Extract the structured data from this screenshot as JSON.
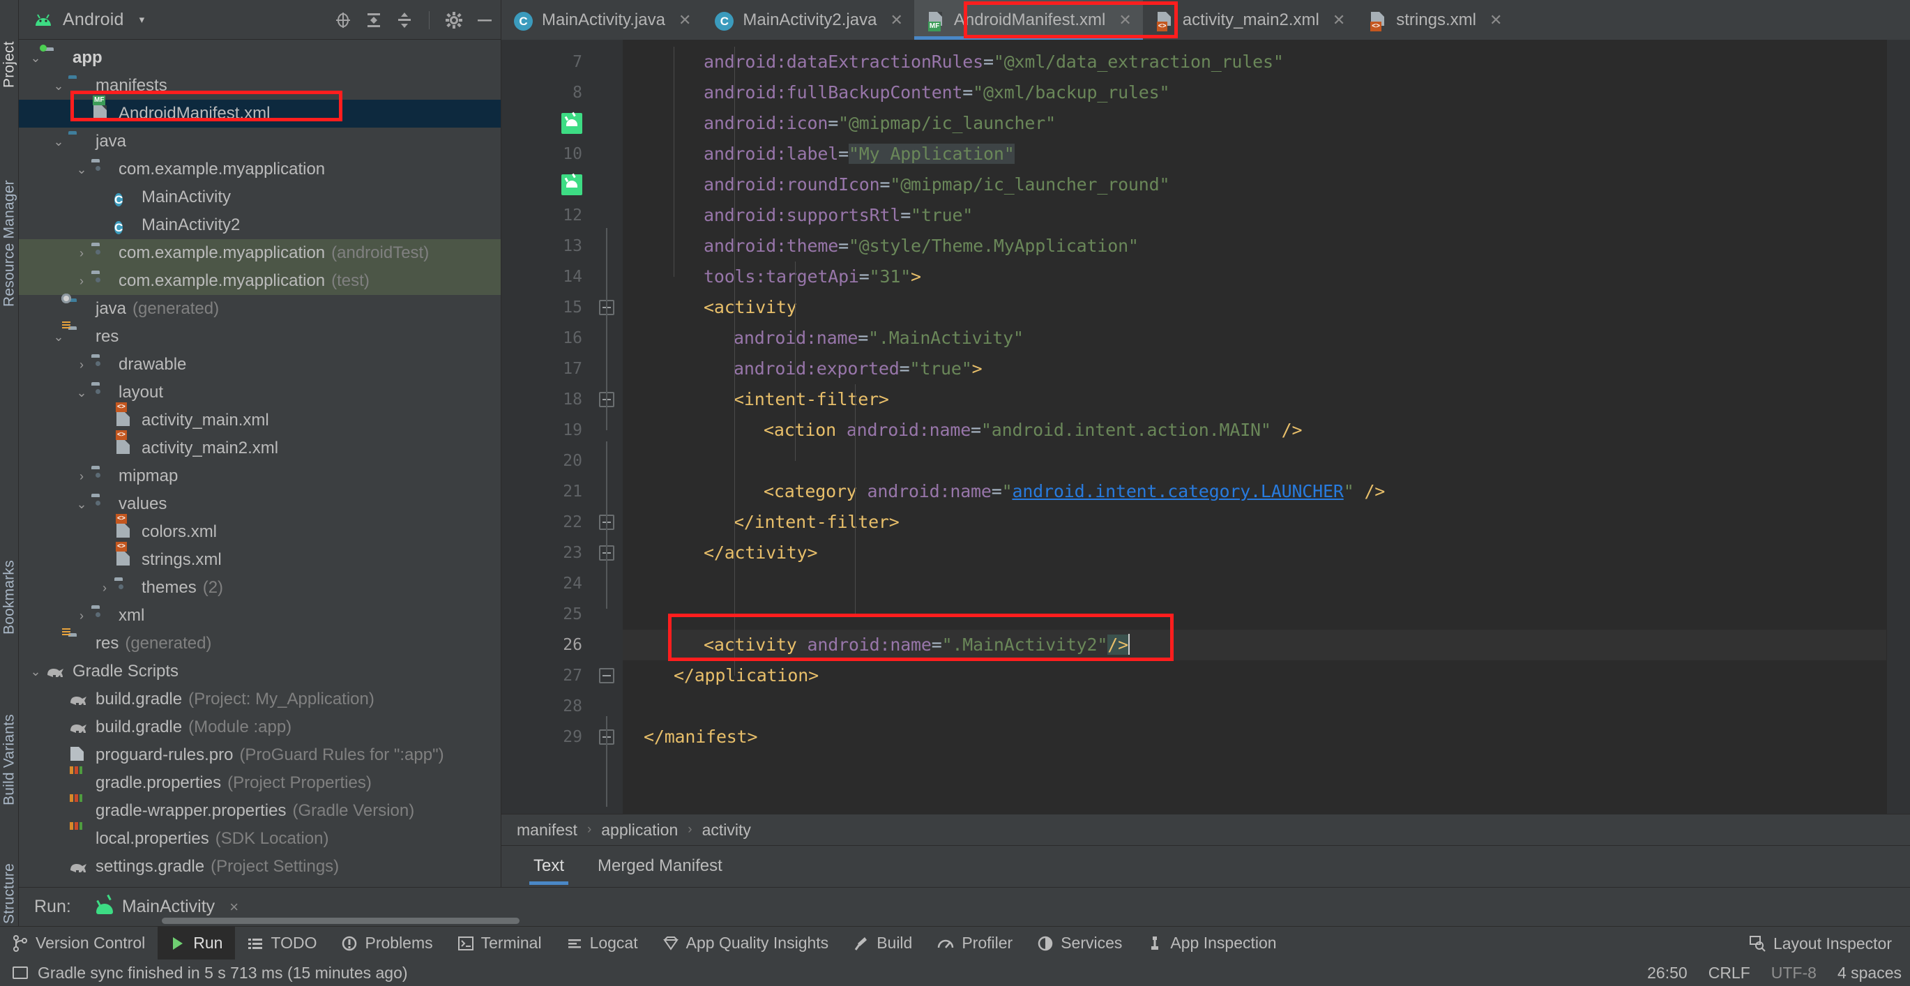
{
  "window": {
    "project_panel_title": "Android",
    "project_vertical_tab": "Project",
    "resource_manager_vertical_tab": "Resource Manager",
    "bookmarks_vertical_tab": "Bookmarks",
    "build_variants_vertical_tab": "Build Variants",
    "structure_vertical_tab": "Structure"
  },
  "project_toolbar": {
    "icons": [
      "locate-icon",
      "expand-all-icon",
      "collapse-all-icon",
      "gear-icon",
      "minimize-icon"
    ]
  },
  "tree": [
    {
      "label": "app",
      "sub": "",
      "depth": 0,
      "arrow": "down",
      "icon": "folder-module",
      "bold": true,
      "state": "normal"
    },
    {
      "label": "manifests",
      "sub": "",
      "depth": 1,
      "arrow": "down",
      "icon": "folder-blue",
      "bold": false,
      "state": "normal"
    },
    {
      "label": "AndroidManifest.xml",
      "sub": "",
      "depth": 2,
      "arrow": "none",
      "icon": "file-manifest",
      "bold": false,
      "state": "selected"
    },
    {
      "label": "java",
      "sub": "",
      "depth": 1,
      "arrow": "down",
      "icon": "folder-blue",
      "bold": false,
      "state": "normal"
    },
    {
      "label": "com.example.myapplication",
      "sub": "",
      "depth": 2,
      "arrow": "down",
      "icon": "folder-package",
      "bold": false,
      "state": "normal"
    },
    {
      "label": "MainActivity",
      "sub": "",
      "depth": 3,
      "arrow": "none",
      "icon": "class",
      "bold": false,
      "state": "normal"
    },
    {
      "label": "MainActivity2",
      "sub": "",
      "depth": 3,
      "arrow": "none",
      "icon": "class",
      "bold": false,
      "state": "normal"
    },
    {
      "label": "com.example.myapplication",
      "sub": "(androidTest)",
      "depth": 2,
      "arrow": "right",
      "icon": "folder-package",
      "bold": false,
      "state": "test"
    },
    {
      "label": "com.example.myapplication",
      "sub": "(test)",
      "depth": 2,
      "arrow": "right",
      "icon": "folder-package",
      "bold": false,
      "state": "test"
    },
    {
      "label": "java",
      "sub": "(generated)",
      "depth": 1,
      "arrow": "none",
      "icon": "folder-generated",
      "bold": false,
      "state": "normal"
    },
    {
      "label": "res",
      "sub": "",
      "depth": 1,
      "arrow": "down",
      "icon": "folder-res",
      "bold": false,
      "state": "normal"
    },
    {
      "label": "drawable",
      "sub": "",
      "depth": 2,
      "arrow": "right",
      "icon": "folder-package",
      "bold": false,
      "state": "normal"
    },
    {
      "label": "layout",
      "sub": "",
      "depth": 2,
      "arrow": "down",
      "icon": "folder-package",
      "bold": false,
      "state": "normal"
    },
    {
      "label": "activity_main.xml",
      "sub": "",
      "depth": 3,
      "arrow": "none",
      "icon": "file-xml",
      "bold": false,
      "state": "normal"
    },
    {
      "label": "activity_main2.xml",
      "sub": "",
      "depth": 3,
      "arrow": "none",
      "icon": "file-xml",
      "bold": false,
      "state": "normal"
    },
    {
      "label": "mipmap",
      "sub": "",
      "depth": 2,
      "arrow": "right",
      "icon": "folder-package",
      "bold": false,
      "state": "normal"
    },
    {
      "label": "values",
      "sub": "",
      "depth": 2,
      "arrow": "down",
      "icon": "folder-package",
      "bold": false,
      "state": "normal"
    },
    {
      "label": "colors.xml",
      "sub": "",
      "depth": 3,
      "arrow": "none",
      "icon": "file-xml",
      "bold": false,
      "state": "normal"
    },
    {
      "label": "strings.xml",
      "sub": "",
      "depth": 3,
      "arrow": "none",
      "icon": "file-xml",
      "bold": false,
      "state": "normal"
    },
    {
      "label": "themes",
      "sub": "(2)",
      "depth": 3,
      "arrow": "right",
      "icon": "folder-package",
      "bold": false,
      "state": "normal"
    },
    {
      "label": "xml",
      "sub": "",
      "depth": 2,
      "arrow": "right",
      "icon": "folder-package",
      "bold": false,
      "state": "normal"
    },
    {
      "label": "res",
      "sub": "(generated)",
      "depth": 1,
      "arrow": "none",
      "icon": "folder-res-generated",
      "bold": false,
      "state": "normal"
    },
    {
      "label": "Gradle Scripts",
      "sub": "",
      "depth": 0,
      "arrow": "down",
      "icon": "gradle",
      "bold": false,
      "state": "normal"
    },
    {
      "label": "build.gradle",
      "sub": "(Project: My_Application)",
      "depth": 1,
      "arrow": "none",
      "icon": "gradle",
      "bold": false,
      "state": "normal"
    },
    {
      "label": "build.gradle",
      "sub": "(Module :app)",
      "depth": 1,
      "arrow": "none",
      "icon": "gradle",
      "bold": false,
      "state": "normal"
    },
    {
      "label": "proguard-rules.pro",
      "sub": "(ProGuard Rules for \":app\")",
      "depth": 1,
      "arrow": "none",
      "icon": "file-text",
      "bold": false,
      "state": "normal"
    },
    {
      "label": "gradle.properties",
      "sub": "(Project Properties)",
      "depth": 1,
      "arrow": "none",
      "icon": "file-properties",
      "bold": false,
      "state": "normal"
    },
    {
      "label": "gradle-wrapper.properties",
      "sub": "(Gradle Version)",
      "depth": 1,
      "arrow": "none",
      "icon": "file-properties",
      "bold": false,
      "state": "normal"
    },
    {
      "label": "local.properties",
      "sub": "(SDK Location)",
      "depth": 1,
      "arrow": "none",
      "icon": "file-properties",
      "bold": false,
      "state": "normal"
    },
    {
      "label": "settings.gradle",
      "sub": "(Project Settings)",
      "depth": 1,
      "arrow": "none",
      "icon": "gradle",
      "bold": false,
      "state": "normal"
    }
  ],
  "editor_tabs": [
    {
      "label": "MainActivity.java",
      "icon": "class-icon",
      "active": false
    },
    {
      "label": "MainActivity2.java",
      "icon": "class-icon",
      "active": false
    },
    {
      "label": "AndroidManifest.xml",
      "icon": "manifest-icon",
      "active": true
    },
    {
      "label": "activity_main2.xml",
      "icon": "xml-icon",
      "active": false
    },
    {
      "label": "strings.xml",
      "icon": "xml-icon",
      "active": false
    }
  ],
  "code": {
    "first_line_number": 7,
    "lines": [
      {
        "n": 7,
        "android_marker": false,
        "fold": "none",
        "indent": 2,
        "text": "android:dataExtractionRules=\"@xml/data_extraction_rules\""
      },
      {
        "n": 8,
        "android_marker": false,
        "fold": "none",
        "indent": 2,
        "text": "android:fullBackupContent=\"@xml/backup_rules\""
      },
      {
        "n": 9,
        "android_marker": true,
        "fold": "none",
        "indent": 2,
        "text": "android:icon=\"@mipmap/ic_launcher\""
      },
      {
        "n": 10,
        "android_marker": false,
        "fold": "none",
        "indent": 2,
        "text": "android:label=\"My Application\""
      },
      {
        "n": 11,
        "android_marker": true,
        "fold": "none",
        "indent": 2,
        "text": "android:roundIcon=\"@mipmap/ic_launcher_round\""
      },
      {
        "n": 12,
        "android_marker": false,
        "fold": "none",
        "indent": 2,
        "text": "android:supportsRtl=\"true\""
      },
      {
        "n": 13,
        "android_marker": false,
        "fold": "none",
        "indent": 2,
        "text": "android:theme=\"@style/Theme.MyApplication\""
      },
      {
        "n": 14,
        "android_marker": false,
        "fold": "none",
        "indent": 2,
        "text": "tools:targetApi=\"31\">"
      },
      {
        "n": 15,
        "android_marker": false,
        "fold": "start",
        "indent": 2,
        "text": "<activity"
      },
      {
        "n": 16,
        "android_marker": false,
        "fold": "none",
        "indent": 3,
        "text": "android:name=\".MainActivity\""
      },
      {
        "n": 17,
        "android_marker": false,
        "fold": "none",
        "indent": 3,
        "text": "android:exported=\"true\">"
      },
      {
        "n": 18,
        "android_marker": false,
        "fold": "start",
        "indent": 3,
        "text": "<intent-filter>"
      },
      {
        "n": 19,
        "android_marker": false,
        "fold": "none",
        "indent": 4,
        "text": "<action android:name=\"android.intent.action.MAIN\" />"
      },
      {
        "n": 20,
        "android_marker": false,
        "fold": "none",
        "indent": 0,
        "text": ""
      },
      {
        "n": 21,
        "android_marker": false,
        "fold": "none",
        "indent": 4,
        "text": "<category android:name=\"android.intent.category.LAUNCHER\" />"
      },
      {
        "n": 22,
        "android_marker": false,
        "fold": "end",
        "indent": 3,
        "text": "</intent-filter>"
      },
      {
        "n": 23,
        "android_marker": false,
        "fold": "end",
        "indent": 2,
        "text": "</activity>"
      },
      {
        "n": 24,
        "android_marker": false,
        "fold": "none",
        "indent": 0,
        "text": ""
      },
      {
        "n": 25,
        "android_marker": false,
        "fold": "none",
        "indent": 0,
        "text": ""
      },
      {
        "n": 26,
        "android_marker": false,
        "fold": "none",
        "indent": 2,
        "text": "<activity android:name=\".MainActivity2\"/>",
        "current": true
      },
      {
        "n": 27,
        "android_marker": false,
        "fold": "end",
        "indent": 1,
        "text": "</application>"
      },
      {
        "n": 28,
        "android_marker": false,
        "fold": "none",
        "indent": 0,
        "text": ""
      },
      {
        "n": 29,
        "android_marker": false,
        "fold": "end",
        "indent": 0,
        "text": "</manifest>"
      }
    ]
  },
  "breadcrumb": [
    "manifest",
    "application",
    "activity"
  ],
  "editor_modes": [
    {
      "label": "Text",
      "active": true
    },
    {
      "label": "Merged Manifest",
      "active": false
    }
  ],
  "run_panel": {
    "label": "Run:",
    "config_name": "MainActivity",
    "close_label": "×"
  },
  "tool_windows": [
    {
      "label": "Version Control",
      "icon": "branch-icon",
      "active": false
    },
    {
      "label": "Run",
      "icon": "play-icon",
      "active": true
    },
    {
      "label": "TODO",
      "icon": "list-icon",
      "active": false
    },
    {
      "label": "Problems",
      "icon": "warning-icon",
      "active": false
    },
    {
      "label": "Terminal",
      "icon": "terminal-icon",
      "active": false
    },
    {
      "label": "Logcat",
      "icon": "logcat-icon",
      "active": false
    },
    {
      "label": "App Quality Insights",
      "icon": "gem-icon",
      "active": false
    },
    {
      "label": "Build",
      "icon": "hammer-icon",
      "active": false
    },
    {
      "label": "Profiler",
      "icon": "gauge-icon",
      "active": false
    },
    {
      "label": "Services",
      "icon": "services-icon",
      "active": false
    },
    {
      "label": "App Inspection",
      "icon": "inspection-icon",
      "active": false
    }
  ],
  "tool_windows_right": [
    {
      "label": "Layout Inspector",
      "icon": "layout-inspector-icon"
    }
  ],
  "status_bar": {
    "message": "Gradle sync finished in 5 s 713 ms (15 minutes ago)",
    "caret_position": "26:50",
    "line_separator": "CRLF",
    "encoding": "UTF-8",
    "indent": "4 spaces"
  },
  "annotations": {
    "accent_red": "#ff1e1e",
    "accent_blue": "#4a88c7",
    "selection_blue": "#0d293e",
    "test_green": "#4c5647"
  }
}
